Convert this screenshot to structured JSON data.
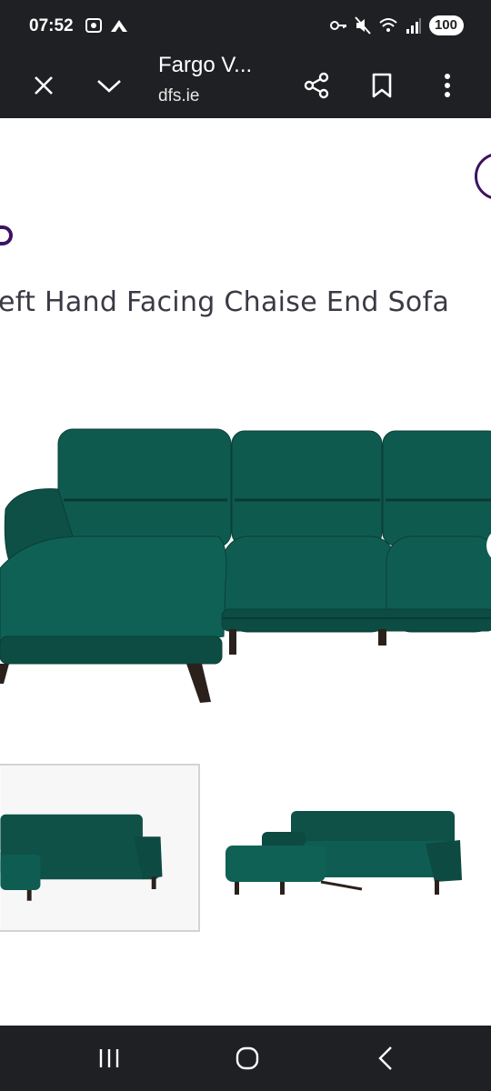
{
  "status_bar": {
    "time": "07:52",
    "battery": "100",
    "icons": [
      "screenshot-icon",
      "app-notification-icon",
      "key-icon",
      "mute-icon",
      "wifi-icon",
      "signal-icon",
      "battery-icon"
    ]
  },
  "toolbar": {
    "title": "Fargo V...",
    "url": "dfs.ie",
    "icons": [
      "close-icon",
      "chevron-down-icon",
      "share-icon",
      "bookmark-icon",
      "more-icon"
    ]
  },
  "product": {
    "title_fragment": "eft Hand Facing Chaise End Sofa",
    "sofa_color": "#0f5147"
  },
  "colors": {
    "brand_purple": "#3c1361",
    "bar_background": "#1f2023"
  },
  "nav": {
    "icons": [
      "recent-apps-icon",
      "home-icon",
      "back-icon"
    ]
  }
}
